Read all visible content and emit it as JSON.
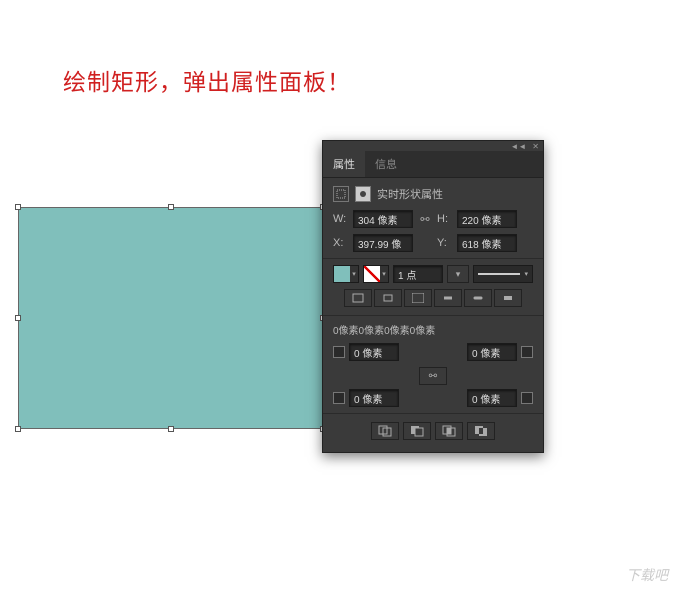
{
  "caption": "绘制矩形，弹出属性面板！",
  "panel": {
    "tabs": {
      "properties": "属性",
      "info": "信息"
    },
    "section_title": "实时形状属性",
    "width": {
      "label": "W:",
      "value": "304 像素"
    },
    "height": {
      "label": "H:",
      "value": "220 像素"
    },
    "x": {
      "label": "X:",
      "value": "397.99 像"
    },
    "y": {
      "label": "Y:",
      "value": "618 像素"
    },
    "stroke_width": "1 点",
    "corner_summary": "0像素0像素0像素0像素",
    "corners": {
      "tl": "0 像素",
      "tr": "0 像素",
      "bl": "0 像素",
      "br": "0 像素"
    }
  },
  "watermark": "下载吧"
}
